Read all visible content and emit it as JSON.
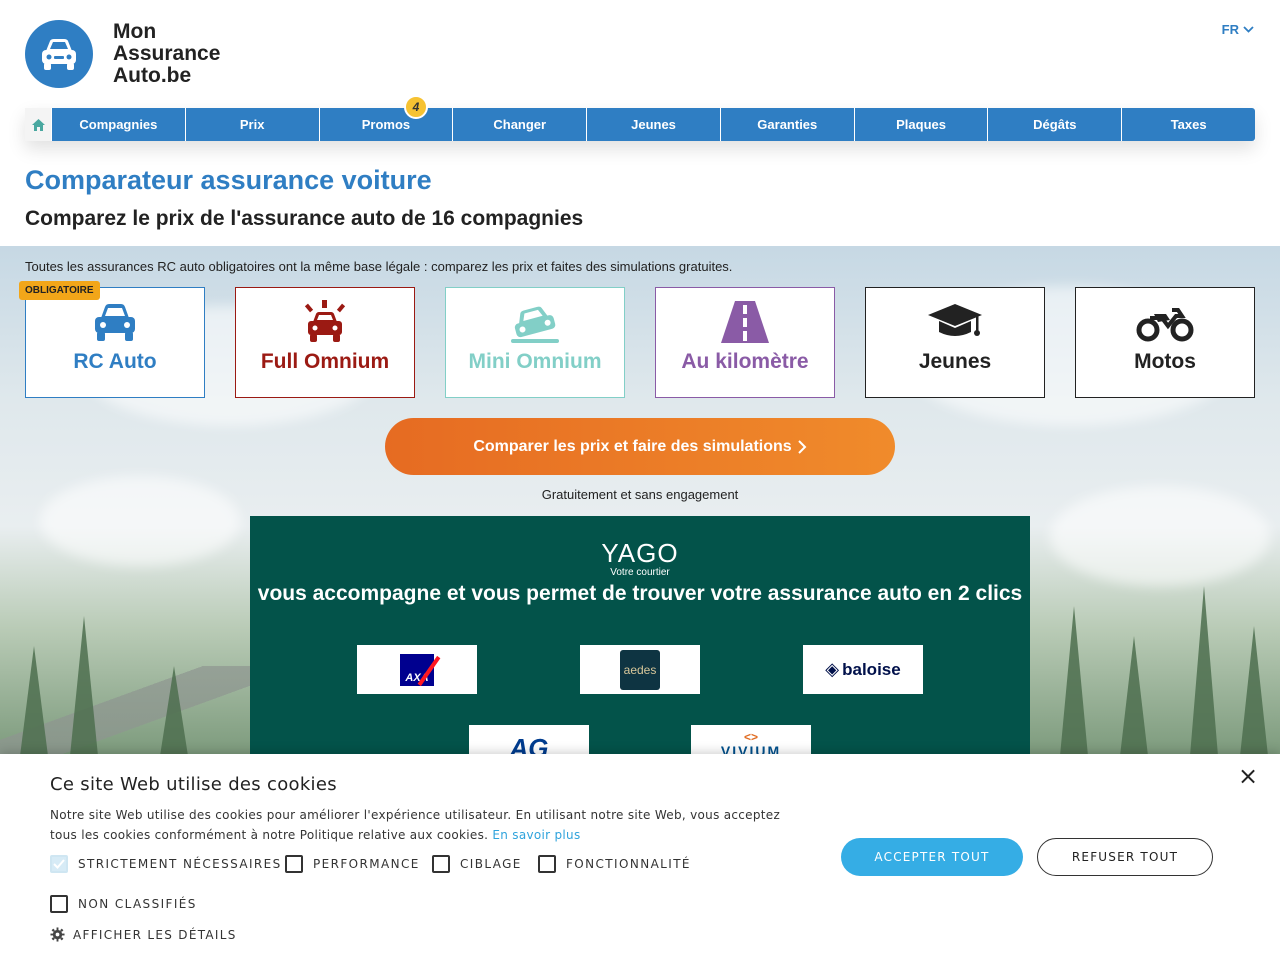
{
  "header": {
    "logo_lines": [
      "Mon",
      "Assurance",
      "Auto.be"
    ],
    "language": "FR"
  },
  "nav": {
    "items": [
      "Compagnies",
      "Prix",
      "Promos",
      "Changer",
      "Jeunes",
      "Garanties",
      "Plaques",
      "Dégâts",
      "Taxes"
    ],
    "promo_count": "4"
  },
  "page": {
    "title": "Comparateur assurance voiture",
    "subtitle": "Comparez le prix de l'assurance auto de 16 compagnies",
    "note": "Toutes les assurances RC auto obligatoires ont la même base légale : comparez les prix et faites des simulations gratuites."
  },
  "cards": [
    {
      "label": "RC Auto",
      "color": "#2f7ec3",
      "badge": "OBLIGATOIRE",
      "icon": "car-icon"
    },
    {
      "label": "Full Omnium",
      "color": "#9b1a13",
      "icon": "car-alarm-icon"
    },
    {
      "label": "Mini Omnium",
      "color": "#82cfc7",
      "icon": "car-crash-icon"
    },
    {
      "label": "Au kilomètre",
      "color": "#8a5ba6",
      "icon": "road-icon"
    },
    {
      "label": "Jeunes",
      "color": "#222222",
      "icon": "graduation-cap-icon"
    },
    {
      "label": "Motos",
      "color": "#222222",
      "icon": "motorcycle-icon"
    }
  ],
  "cta": {
    "label": "Comparer les prix et faire des simulations",
    "note": "Gratuitement et sans engagement"
  },
  "yago": {
    "brand": "YAGO",
    "tagline": "Votre courtier",
    "text": "vous accompagne et vous permet de trouver votre assurance auto en 2 clics",
    "insurers": [
      "AXA",
      "aedes",
      "baloise",
      "AG",
      "VIVIUM"
    ]
  },
  "cookie": {
    "title": "Ce site Web utilise des cookies",
    "description": "Notre site Web utilise des cookies pour améliorer l'expérience utilisateur. En utilisant notre site Web, vous acceptez tous les cookies conformément à notre Politique relative aux cookies.",
    "learn_more": "En savoir plus",
    "options": [
      "STRICTEMENT NÉCESSAIRES",
      "PERFORMANCE",
      "CIBLAGE",
      "FONCTIONNALITÉ",
      "NON CLASSIFIÉS"
    ],
    "accept": "ACCEPTER TOUT",
    "refuse": "REFUSER TOUT",
    "details": "AFFICHER LES DÉTAILS",
    "close": "×"
  }
}
